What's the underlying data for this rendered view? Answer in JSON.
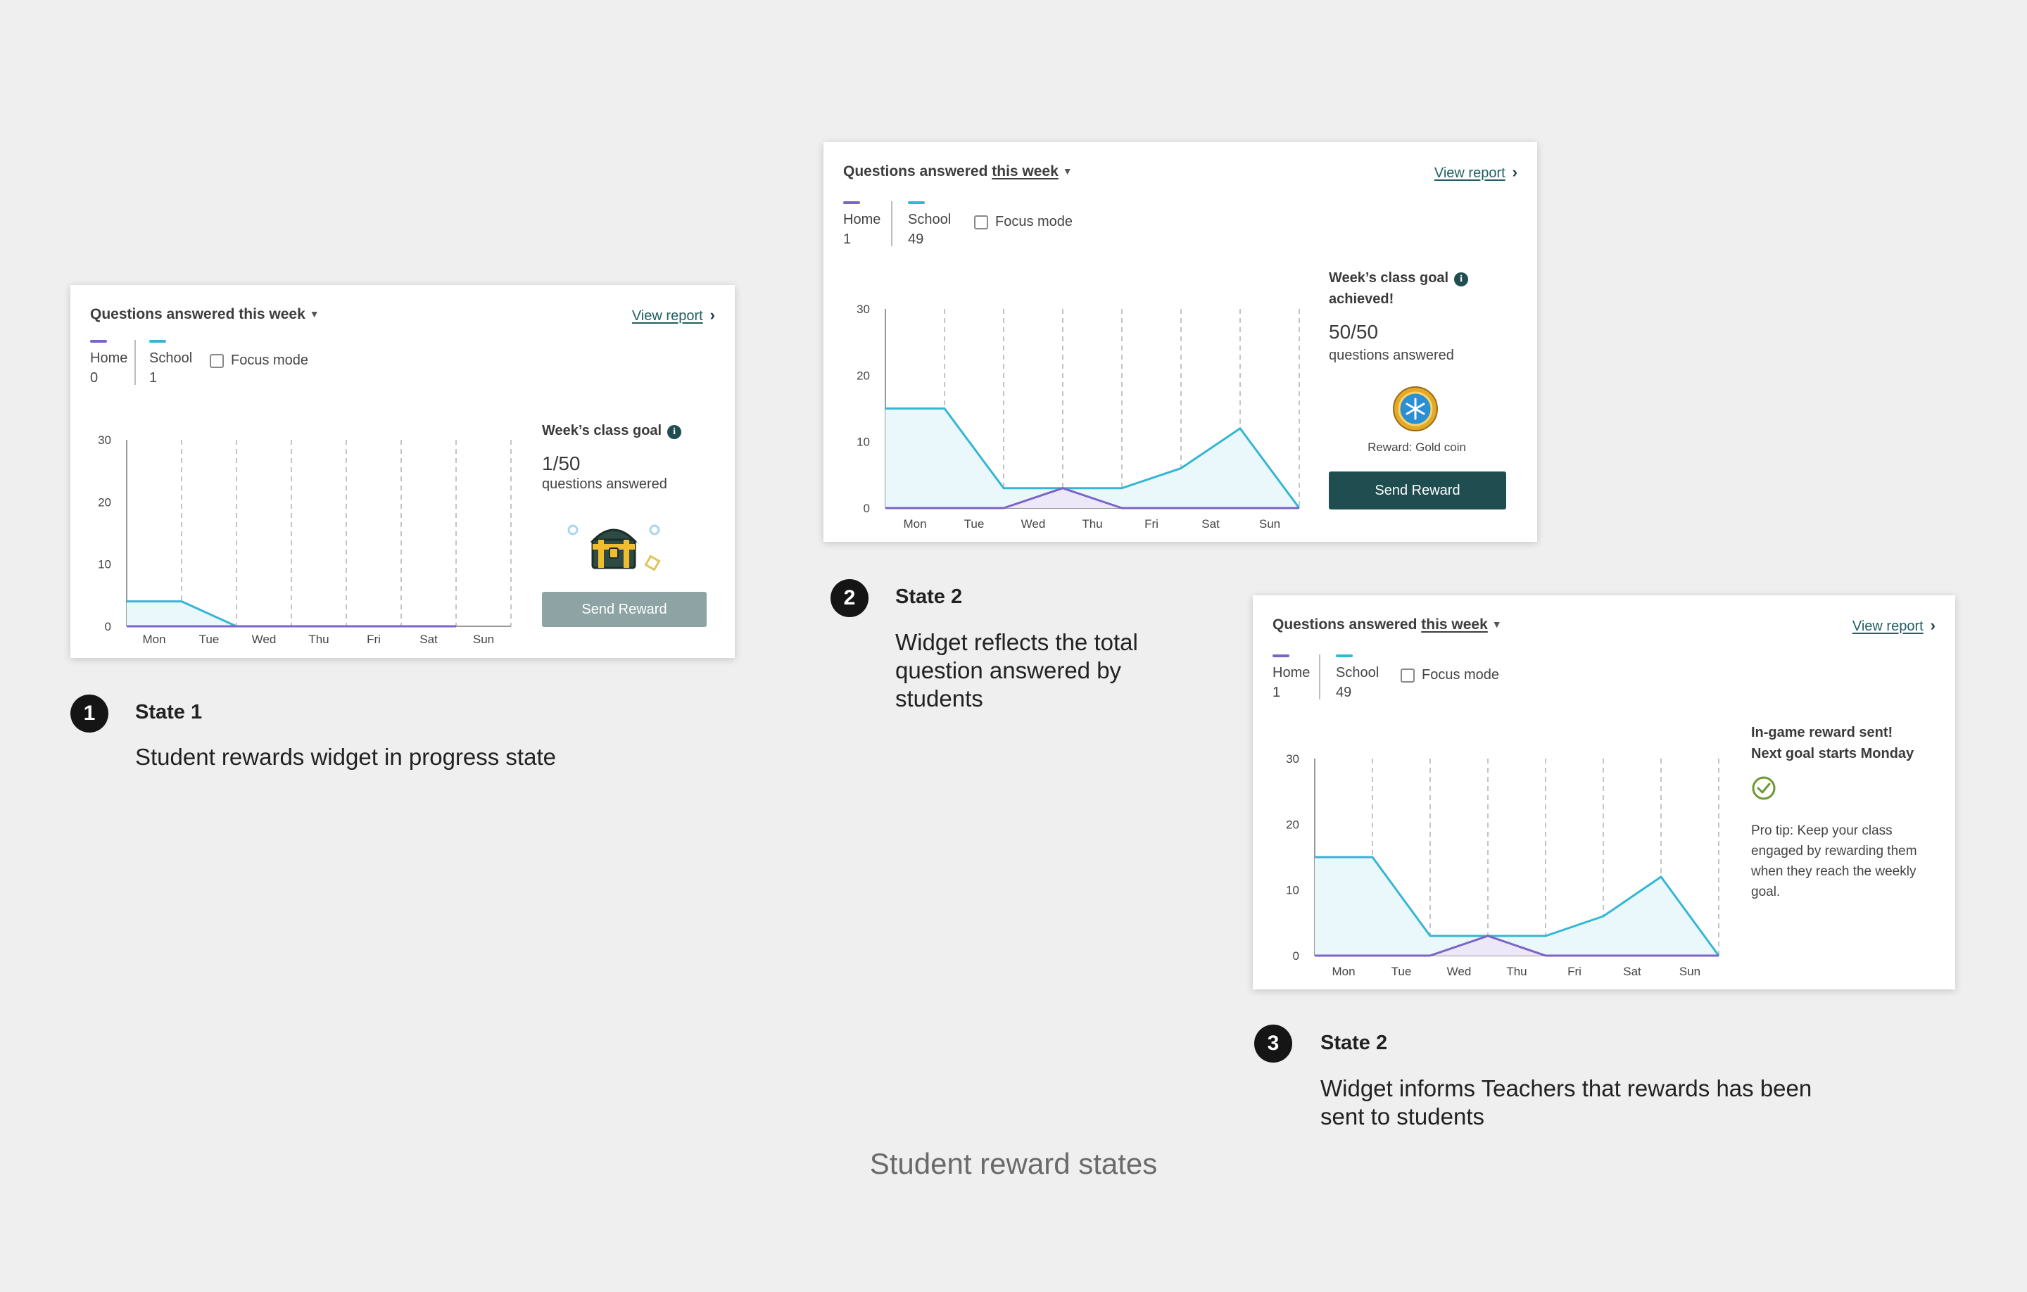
{
  "colors": {
    "home": "#7b63c8",
    "school": "#35b6d4",
    "area_fill": "#eaf7fb",
    "button_dark": "#1f4d50",
    "button_disabled": "#8ea3a3",
    "check_green": "#6a9a2e",
    "background": "#efefef"
  },
  "widgets": [
    {
      "header_prefix": "Questions answered",
      "header_period": "this week",
      "view_report": "View report",
      "legend": {
        "home_label": "Home",
        "home_value": "0",
        "school_label": "School",
        "school_value": "1"
      },
      "focus_mode": "Focus mode",
      "side_title": "Week’s class goal",
      "goal_count": "1/50",
      "goal_sub": "questions answered",
      "send_button": "Send Reward",
      "chart_data": {
        "type": "line",
        "categories": [
          "Mon",
          "Tue",
          "Wed",
          "Thu",
          "Fri",
          "Sat",
          "Sun"
        ],
        "y_ticks": [
          0,
          10,
          20,
          30
        ],
        "ylim": [
          0,
          30
        ],
        "series": [
          {
            "name": "Home",
            "values": [
              0,
              0,
              0,
              0,
              0,
              0,
              0
            ]
          },
          {
            "name": "School",
            "values": [
              4,
              4,
              0,
              0,
              0,
              0,
              0
            ]
          }
        ]
      }
    },
    {
      "header_prefix": "Questions answered",
      "header_period": "this week",
      "view_report": "View report",
      "legend": {
        "home_label": "Home",
        "home_value": "1",
        "school_label": "School",
        "school_value": "49"
      },
      "focus_mode": "Focus mode",
      "side_title_line1": "Week’s class goal",
      "side_title_line2": "achieved!",
      "goal_count": "50/50",
      "goal_sub": "questions answered",
      "reward_caption": "Reward: Gold coin",
      "send_button": "Send Reward",
      "chart_data": {
        "type": "line",
        "categories": [
          "Mon",
          "Tue",
          "Wed",
          "Thu",
          "Fri",
          "Sat",
          "Sun"
        ],
        "y_ticks": [
          0,
          10,
          20,
          30
        ],
        "ylim": [
          0,
          30
        ],
        "series": [
          {
            "name": "Home",
            "values": [
              0,
              0,
              0,
              3,
              0,
              0,
              0,
              0
            ]
          },
          {
            "name": "School",
            "values": [
              15,
              15,
              3,
              3,
              3,
              6,
              12,
              0
            ]
          }
        ]
      }
    },
    {
      "header_prefix": "Questions answered",
      "header_period": "this week",
      "view_report": "View report",
      "legend": {
        "home_label": "Home",
        "home_value": "1",
        "school_label": "School",
        "school_value": "49"
      },
      "focus_mode": "Focus mode",
      "sent_line1": "In-game reward sent!",
      "sent_line2": "Next goal starts Monday",
      "pro_tip": "Pro tip: Keep your class engaged by rewarding them when they reach the weekly goal.",
      "chart_data": {
        "type": "line",
        "categories": [
          "Mon",
          "Tue",
          "Wed",
          "Thu",
          "Fri",
          "Sat",
          "Sun"
        ],
        "y_ticks": [
          0,
          10,
          20,
          30
        ],
        "ylim": [
          0,
          30
        ],
        "series": [
          {
            "name": "Home",
            "values": [
              0,
              0,
              0,
              3,
              0,
              0,
              0,
              0
            ]
          },
          {
            "name": "School",
            "values": [
              15,
              15,
              3,
              3,
              3,
              6,
              12,
              0
            ]
          }
        ]
      }
    }
  ],
  "steps": [
    {
      "number": "1",
      "title": "State 1",
      "description": "Student rewards widget in progress state"
    },
    {
      "number": "2",
      "title": "State 2",
      "description": "Widget reflects the total question answered by students"
    },
    {
      "number": "3",
      "title": "State 2",
      "description": "Widget informs Teachers that rewards has been sent to students"
    }
  ],
  "footer_title": "Student reward states"
}
